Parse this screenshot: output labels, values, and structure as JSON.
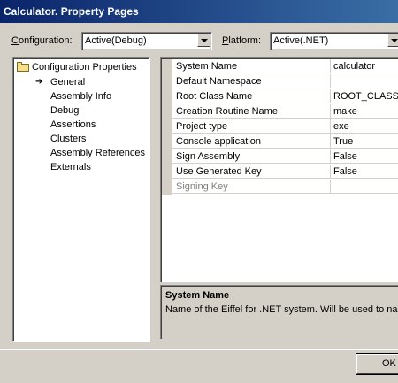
{
  "window": {
    "title": "Calculator. Property Pages"
  },
  "header": {
    "configuration_label_prefix": "C",
    "configuration_label_rest": "onfiguration:",
    "configuration_value": "Active(Debug)",
    "platform_label_prefix": "P",
    "platform_label_rest": "latform:",
    "platform_value": "Active(.NET)"
  },
  "tree": {
    "root": "Configuration Properties",
    "items": [
      "General",
      "Assembly Info",
      "Debug",
      "Assertions",
      "Clusters",
      "Assembly References",
      "Externals"
    ],
    "selected": "General"
  },
  "properties": [
    {
      "name": "System Name",
      "value": "calculator"
    },
    {
      "name": "Default Namespace",
      "value": ""
    },
    {
      "name": "Root Class Name",
      "value": "ROOT_CLASS"
    },
    {
      "name": "Creation Routine Name",
      "value": "make"
    },
    {
      "name": "Project type",
      "value": "exe"
    },
    {
      "name": "Console application",
      "value": "True"
    },
    {
      "name": "Sign Assembly",
      "value": "False"
    },
    {
      "name": "Use Generated Key",
      "value": "False"
    },
    {
      "name": "Signing Key",
      "value": "",
      "disabled": true
    }
  ],
  "description": {
    "title": "System Name",
    "text": "Name of the Eiffel for .NET system. Will be used to na"
  },
  "buttons": {
    "ok": "OK"
  }
}
